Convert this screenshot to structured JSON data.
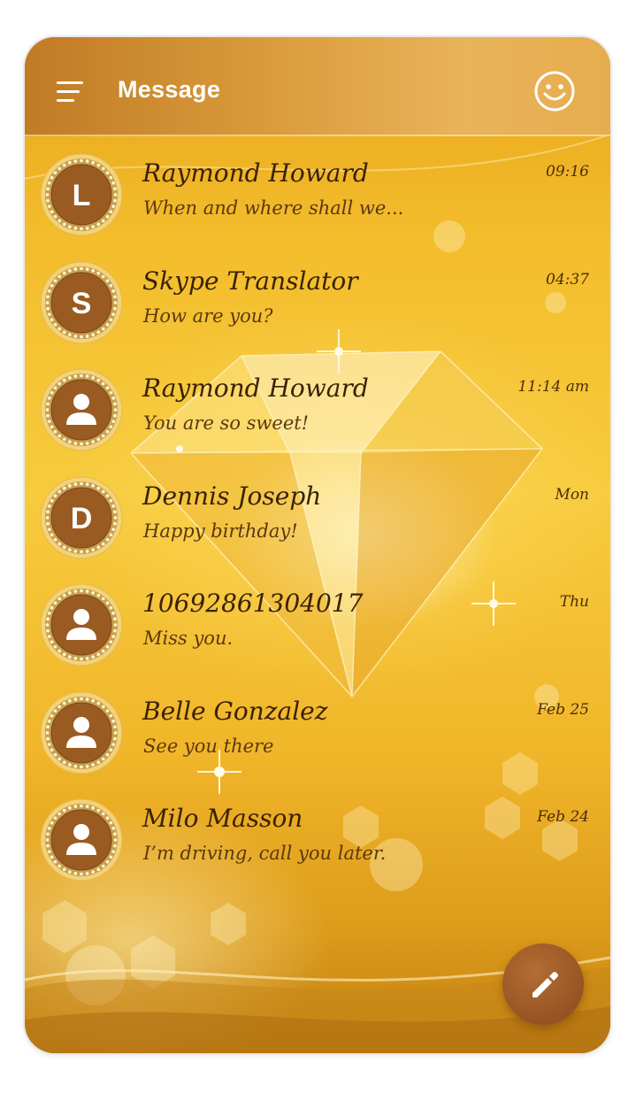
{
  "header": {
    "title": "Message",
    "menu_icon": "hamburger-menu-icon",
    "right_icon": "smiley-face-icon"
  },
  "colors": {
    "header_bg": "#d0913a",
    "avatar_brown": "#9a5b22",
    "fab_brown": "#9b5a27",
    "text_dark": "#3a2206"
  },
  "conversations": [
    {
      "name": "Raymond Howard",
      "snippet": "When and where shall we...",
      "time": "09:16",
      "avatar_type": "letter",
      "avatar_letter": "L"
    },
    {
      "name": "Skype Translator",
      "snippet": "How are you?",
      "time": "04:37",
      "avatar_type": "letter",
      "avatar_letter": "S"
    },
    {
      "name": "Raymond Howard",
      "snippet": "You are so sweet!",
      "time": "11:14 am",
      "avatar_type": "person",
      "avatar_letter": ""
    },
    {
      "name": "Dennis Joseph",
      "snippet": "Happy birthday!",
      "time": "Mon",
      "avatar_type": "letter",
      "avatar_letter": "D"
    },
    {
      "name": "10692861304017",
      "snippet": "Miss you.",
      "time": "Thu",
      "avatar_type": "person",
      "avatar_letter": ""
    },
    {
      "name": "Belle Gonzalez",
      "snippet": "See you there",
      "time": "Feb 25",
      "avatar_type": "person",
      "avatar_letter": ""
    },
    {
      "name": "Milo Masson",
      "snippet": "I’m driving, call you later.",
      "time": "Feb 24",
      "avatar_type": "person",
      "avatar_letter": ""
    }
  ],
  "fab": {
    "icon": "pencil-compose-icon"
  }
}
